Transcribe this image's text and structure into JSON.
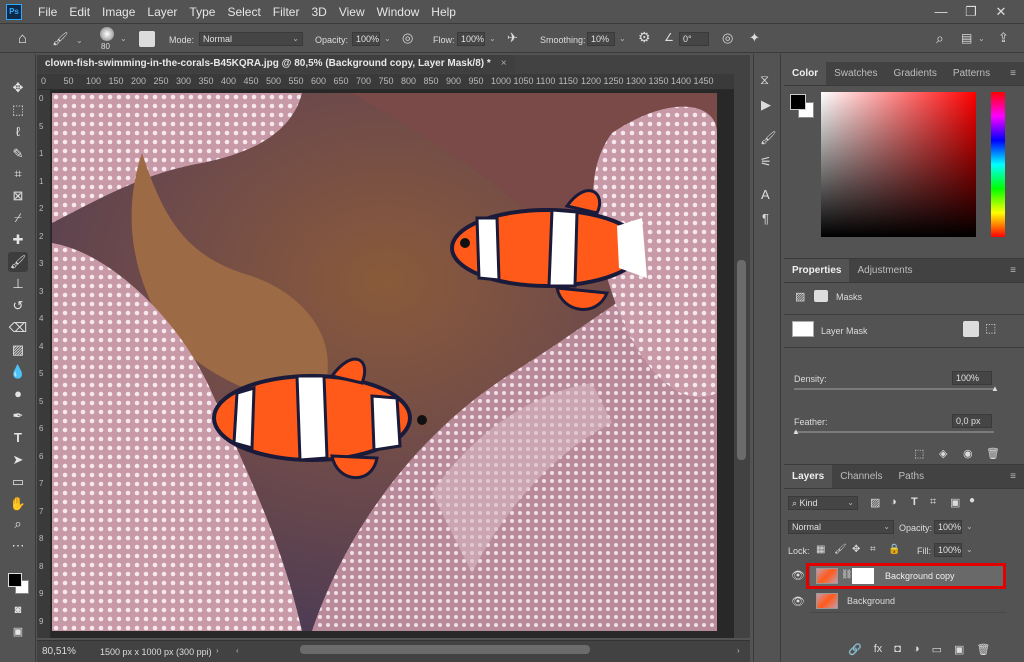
{
  "app": {
    "logo": "Ps",
    "menu": [
      "File",
      "Edit",
      "Image",
      "Layer",
      "Type",
      "Select",
      "Filter",
      "3D",
      "View",
      "Window",
      "Help"
    ]
  },
  "window_controls": [
    "—",
    "❐",
    "✕"
  ],
  "options": {
    "brush_size": "80",
    "mode_label": "Mode:",
    "mode_value": "Normal",
    "opacity_label": "Opacity:",
    "opacity_value": "100%",
    "flow_label": "Flow:",
    "flow_value": "100%",
    "smoothing_label": "Smoothing:",
    "smoothing_value": "10%",
    "angle_value": "0°"
  },
  "document": {
    "tab_title": "clown-fish-swimming-in-the-corals-B45KQRA.jpg @ 80,5% (Background copy, Layer Mask/8) *",
    "tab_close": "×",
    "zoom": "80,51%",
    "info": "1500 px x 1000 px (300 ppi)",
    "ruler_h": [
      "0",
      "50",
      "100",
      "150",
      "200",
      "250",
      "300",
      "350",
      "400",
      "450",
      "500",
      "550",
      "600",
      "650",
      "700",
      "750",
      "800",
      "850",
      "900",
      "950",
      "1000",
      "1050",
      "1100",
      "1150",
      "1200",
      "1250",
      "1300",
      "1350",
      "1400",
      "1450"
    ],
    "ruler_v": [
      "0",
      "5",
      "1",
      "1",
      "2",
      "2",
      "3",
      "3",
      "4",
      "4",
      "5",
      "5",
      "6",
      "6",
      "7",
      "7",
      "8",
      "8",
      "9",
      "9"
    ]
  },
  "color_panel": {
    "tabs": [
      "Color",
      "Swatches",
      "Gradients",
      "Patterns"
    ],
    "foreground": "#000000",
    "background": "#ffffff"
  },
  "properties_panel": {
    "tabs": [
      "Properties",
      "Adjustments"
    ],
    "masks_label": "Masks",
    "layer_mask_label": "Layer Mask",
    "density_label": "Density:",
    "density_value": "100%",
    "feather_label": "Feather:",
    "feather_value": "0,0 px"
  },
  "layers_panel": {
    "tabs": [
      "Layers",
      "Channels",
      "Paths"
    ],
    "filter_kind": "Kind",
    "blend_mode": "Normal",
    "opacity_label": "Opacity:",
    "opacity_value": "100%",
    "lock_label": "Lock:",
    "fill_label": "Fill:",
    "fill_value": "100%",
    "layers": [
      {
        "name": "Background copy",
        "selected": true
      },
      {
        "name": "Background",
        "selected": false
      }
    ],
    "footer_icons": [
      "🔗",
      "fx",
      "◘",
      "◑",
      "▭",
      "▣",
      "🗑"
    ]
  }
}
